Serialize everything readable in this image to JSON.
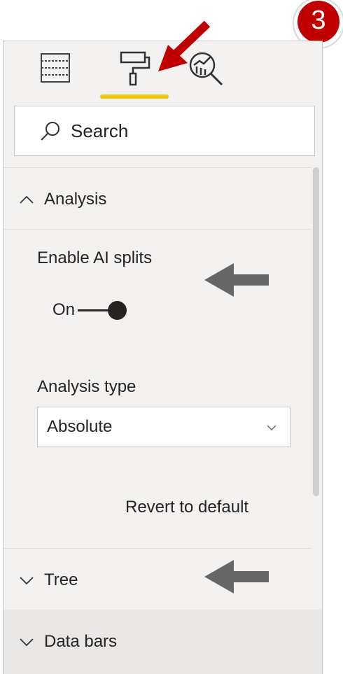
{
  "toolbar": {
    "tabs": [
      {
        "name": "fields",
        "icon": "table-fields-icon"
      },
      {
        "name": "format",
        "icon": "paint-roller-icon",
        "active": true
      },
      {
        "name": "analytics",
        "icon": "analytics-magnifier-icon"
      }
    ],
    "accent_color": "#f2c811"
  },
  "search": {
    "placeholder": "Search"
  },
  "sections": {
    "analysis": {
      "title": "Analysis",
      "expanded": true,
      "enable_ai_splits_label": "Enable AI splits",
      "toggle_state": "On",
      "analysis_type_label": "Analysis type",
      "analysis_type_value": "Absolute",
      "revert_label": "Revert to default"
    },
    "tree": {
      "title": "Tree",
      "expanded": false
    },
    "data_bars": {
      "title": "Data bars",
      "expanded": false
    }
  },
  "callout": {
    "step_number": "3",
    "color": "#c00000"
  }
}
